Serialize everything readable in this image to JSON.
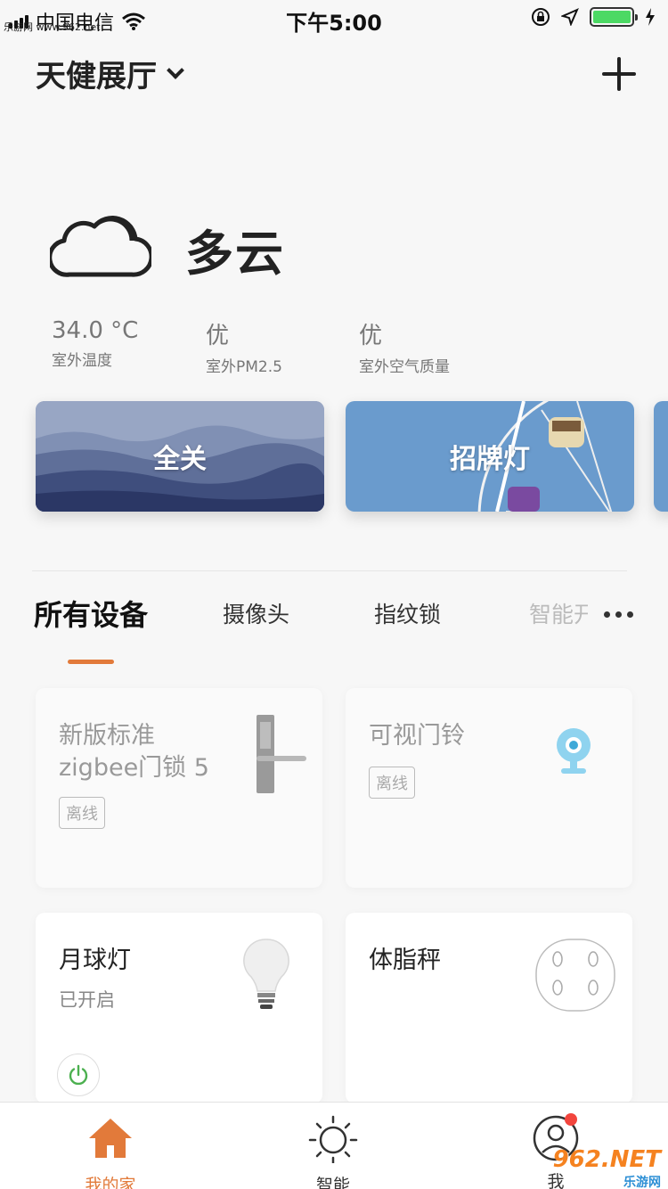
{
  "status_bar": {
    "carrier": "中国电信",
    "time": "下午5:00",
    "watermark": "乐游网 www.962.net"
  },
  "header": {
    "home_name": "天健展厅"
  },
  "weather": {
    "condition": "多云",
    "icon": "cloud-icon",
    "stats": [
      {
        "value": "34.0 °C",
        "label": "室外温度"
      },
      {
        "value": "优",
        "label": "室外PM2.5"
      },
      {
        "value": "优",
        "label": "室外空气质量"
      }
    ]
  },
  "scenes": [
    {
      "label": "全关"
    },
    {
      "label": "招牌灯"
    }
  ],
  "tabs": [
    {
      "label": "所有设备"
    },
    {
      "label": "摄像头"
    },
    {
      "label": "指纹锁"
    },
    {
      "label": "智能开关"
    }
  ],
  "devices": [
    {
      "name_line1": "新版标准",
      "name_line2": "zigbee门锁 5",
      "badge": "离线",
      "icon": "door-lock-icon"
    },
    {
      "name_line1": "可视门铃",
      "badge": "离线",
      "icon": "camera-icon"
    },
    {
      "name_line1": "月球灯",
      "state": "已开启",
      "icon": "light-bulb-icon"
    },
    {
      "name_line1": "体脂秤",
      "icon": "scale-icon"
    }
  ],
  "tab_bar": {
    "items": [
      {
        "label": "我的家",
        "icon": "home-icon"
      },
      {
        "label": "智能",
        "icon": "sun-icon"
      },
      {
        "label": "我",
        "icon": "user-icon"
      }
    ]
  },
  "watermark_bottom": {
    "brand": "962.NET",
    "sub": "乐游网"
  },
  "colors": {
    "accent": "#e27a3a",
    "online": "#4cb050",
    "badge_dot": "#f2453d"
  }
}
